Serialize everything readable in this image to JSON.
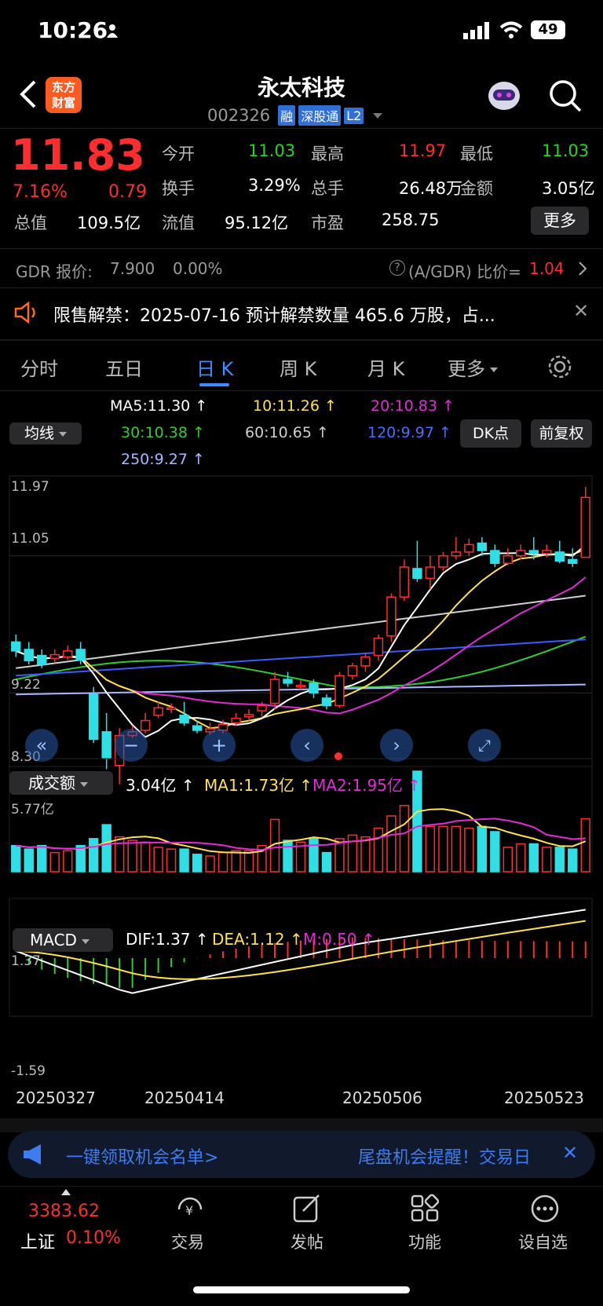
{
  "status": {
    "time": "10:26",
    "battery": "49"
  },
  "header": {
    "title": "永太科技",
    "code": "002326",
    "tags": [
      "融",
      "深股通",
      "L2"
    ],
    "logo": "东方\n财富"
  },
  "quote": {
    "price": "11.83",
    "pct": "7.16%",
    "chg": "0.79",
    "f": [
      [
        "今开",
        "11.03",
        "最高",
        "11.97",
        "最低",
        "11.03"
      ],
      [
        "换手",
        "3.29%",
        "总手",
        "26.48万",
        "金额",
        "3.05亿"
      ],
      [
        "总值",
        "109.5亿",
        "流值",
        "95.12亿",
        "市盈",
        "258.75"
      ]
    ],
    "more": "更多"
  },
  "gdr": {
    "label": "GDR 报价:",
    "price": "7.900",
    "pct": "0.00%",
    "ratio_label": "(A/GDR) 比价=",
    "ratio": "1.04"
  },
  "notice": {
    "text": "限售解禁：2025-07-16 预计解禁数量 465.6 万股，占..."
  },
  "tabs": [
    "分时",
    "五日",
    "日 K",
    "周 K",
    "月 K",
    "更多"
  ],
  "ma": {
    "dropdown": "均线",
    "ma5": "MA5:11.30 ↑",
    "ma10": "10:11.26 ↑",
    "ma20": "20:10.83 ↑",
    "ma30": "30:10.38 ↑",
    "ma60": "60:10.65 ↑",
    "ma120": "120:9.97 ↑",
    "ma250": "250:9.27 ↑",
    "dk": "DK点",
    "fq": "前复权"
  },
  "kaxis": {
    "top": "11.97",
    "mid": "11.05",
    "mid2": "9.22",
    "bottom": "8.30"
  },
  "vol": {
    "dropdown": "成交额",
    "val": "3.04亿 ↑",
    "ma1": "MA1:1.73亿 ↑",
    "ma2": "MA2:1.95亿 ↑",
    "axis": "5.77亿"
  },
  "macd": {
    "dropdown": "MACD",
    "dif": "DIF:1.37 ↑",
    "dea": "DEA:1.12 ↑",
    "m": "M:0.50 ↑",
    "top": "1.37",
    "bottom": "-1.59"
  },
  "dates": [
    "20250327",
    "20250414",
    "20250506",
    "20250523"
  ],
  "banner": {
    "left": "一键领取机会名单>",
    "right": "尾盘机会提醒！交易日"
  },
  "bottom": {
    "index": "3383.62",
    "name": "上证",
    "pct": "0.10%",
    "tabs": [
      "交易",
      "发帖",
      "功能",
      "设自选"
    ]
  },
  "colors": {
    "up": "#ff2d2d",
    "down": "#2ee0e6",
    "ma5": "#ffffff",
    "ma10": "#ffe14a",
    "ma20": "#e22ad8",
    "ma30": "#2ecc2e",
    "ma60": "#cfcfcf",
    "ma120": "#3a5cff",
    "ma250": "#a8b8ff",
    "accent": "#2f6fd6"
  },
  "chart_data": {
    "type": "candlestick",
    "candles": [
      [
        9.9,
        9.78,
        10.0,
        9.7
      ],
      [
        9.8,
        9.65,
        9.9,
        9.6
      ],
      [
        9.72,
        9.6,
        9.8,
        9.55
      ],
      [
        9.68,
        9.73,
        9.8,
        9.62
      ],
      [
        9.7,
        9.78,
        9.85,
        9.66
      ],
      [
        9.8,
        9.66,
        9.9,
        9.6
      ],
      [
        9.2,
        8.6,
        9.3,
        8.55
      ],
      [
        8.7,
        8.35,
        8.95,
        8.2
      ],
      [
        8.25,
        8.65,
        8.75,
        8.0
      ],
      [
        8.65,
        8.7,
        8.78,
        8.62
      ],
      [
        8.72,
        8.85,
        8.95,
        8.68
      ],
      [
        8.92,
        9.02,
        9.1,
        8.88
      ],
      [
        9.0,
        9.02,
        9.08,
        8.95
      ],
      [
        8.92,
        8.82,
        9.1,
        8.78
      ],
      [
        8.78,
        8.72,
        8.85,
        8.68
      ],
      [
        8.7,
        8.74,
        8.82,
        8.66
      ],
      [
        8.72,
        8.8,
        8.86,
        8.68
      ],
      [
        8.82,
        8.88,
        8.95,
        8.78
      ],
      [
        8.9,
        8.93,
        9.0,
        8.85
      ],
      [
        8.98,
        9.05,
        9.1,
        8.9
      ],
      [
        9.08,
        9.4,
        9.5,
        9.0
      ],
      [
        9.4,
        9.35,
        9.5,
        9.3
      ],
      [
        9.3,
        9.32,
        9.4,
        9.26
      ],
      [
        9.35,
        9.22,
        9.4,
        9.15
      ],
      [
        9.15,
        9.05,
        9.2,
        9.0
      ],
      [
        9.05,
        9.45,
        9.5,
        9.02
      ],
      [
        9.45,
        9.58,
        9.62,
        9.4
      ],
      [
        9.58,
        9.7,
        9.75,
        9.5
      ],
      [
        9.72,
        9.95,
        10.0,
        9.65
      ],
      [
        9.98,
        10.5,
        10.55,
        9.9
      ],
      [
        10.5,
        10.9,
        11.0,
        10.45
      ],
      [
        10.88,
        10.75,
        11.25,
        10.7
      ],
      [
        10.75,
        10.9,
        11.05,
        10.6
      ],
      [
        10.9,
        11.05,
        11.1,
        10.85
      ],
      [
        11.05,
        11.1,
        11.3,
        11.0
      ],
      [
        11.1,
        11.2,
        11.28,
        11.05
      ],
      [
        11.22,
        11.12,
        11.3,
        11.05
      ],
      [
        11.12,
        10.95,
        11.2,
        10.9
      ],
      [
        10.95,
        11.05,
        11.15,
        10.92
      ],
      [
        11.05,
        11.12,
        11.2,
        11.0
      ],
      [
        11.12,
        11.08,
        11.3,
        11.0
      ],
      [
        11.08,
        11.12,
        11.2,
        11.03
      ],
      [
        11.1,
        10.98,
        11.25,
        10.95
      ],
      [
        11.0,
        10.95,
        11.15,
        10.9
      ],
      [
        11.03,
        11.83,
        11.97,
        11.03
      ]
    ],
    "volume": [
      1.5,
      1.3,
      1.5,
      1.1,
      1.2,
      1.5,
      1.9,
      2.7,
      2.0,
      1.8,
      1.7,
      1.4,
      1.3,
      1.3,
      1.0,
      0.9,
      1.1,
      1.2,
      1.2,
      1.5,
      3.0,
      1.8,
      1.7,
      1.9,
      1.1,
      1.9,
      2.1,
      2.0,
      2.5,
      3.2,
      3.8,
      5.77,
      2.6,
      2.6,
      2.6,
      2.5,
      2.6,
      2.3,
      1.4,
      1.6,
      1.6,
      1.4,
      1.4,
      1.3,
      3.04
    ]
  }
}
